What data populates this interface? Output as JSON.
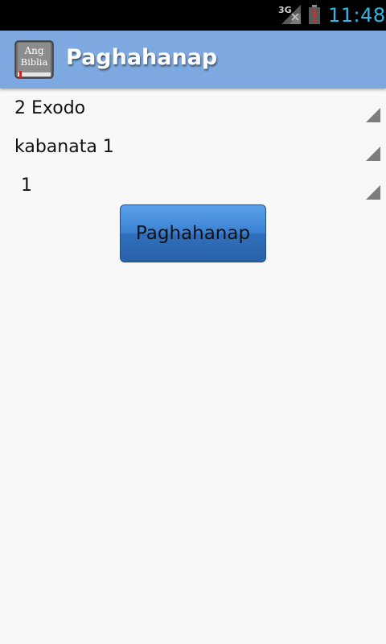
{
  "status_bar": {
    "network": "3G",
    "time": "11:48",
    "icons": [
      "signal-icon",
      "battery-alert-icon"
    ],
    "clock_color": "#33b5e5"
  },
  "action_bar": {
    "icon_text_line1": "Ang",
    "icon_text_line2": "Biblia",
    "title": "Paghahanap",
    "background_color": "#7ea9e0"
  },
  "form": {
    "book_selected": "2 Exodo",
    "chapter_selected": "kabanata 1",
    "verse_selected": "1",
    "search_button_label": "Paghahanap",
    "button_color": "#3b82d4"
  }
}
